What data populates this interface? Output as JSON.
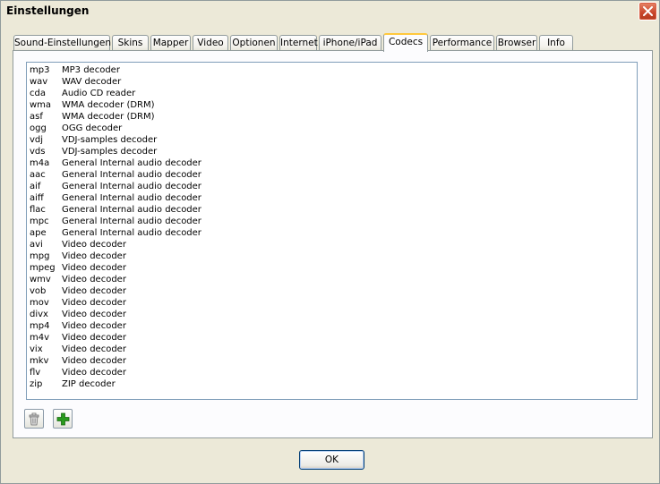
{
  "window": {
    "title": "Einstellungen"
  },
  "tabs": [
    {
      "label": "Sound-Einstellungen"
    },
    {
      "label": "Skins"
    },
    {
      "label": "Mapper"
    },
    {
      "label": "Video"
    },
    {
      "label": "Optionen"
    },
    {
      "label": "Internet"
    },
    {
      "label": "iPhone/iPad"
    },
    {
      "label": "Codecs",
      "active": true
    },
    {
      "label": "Performance"
    },
    {
      "label": "Browser"
    },
    {
      "label": "Info"
    }
  ],
  "codecs": [
    {
      "ext": "mp3",
      "desc": "MP3 decoder"
    },
    {
      "ext": "wav",
      "desc": "WAV decoder"
    },
    {
      "ext": "cda",
      "desc": "Audio CD reader"
    },
    {
      "ext": "wma",
      "desc": "WMA decoder (DRM)"
    },
    {
      "ext": "asf",
      "desc": "WMA decoder (DRM)"
    },
    {
      "ext": "ogg",
      "desc": "OGG decoder"
    },
    {
      "ext": "vdj",
      "desc": "VDJ-samples decoder"
    },
    {
      "ext": "vds",
      "desc": "VDJ-samples decoder"
    },
    {
      "ext": "m4a",
      "desc": "General Internal audio decoder"
    },
    {
      "ext": "aac",
      "desc": "General Internal audio decoder"
    },
    {
      "ext": "aif",
      "desc": "General Internal audio decoder"
    },
    {
      "ext": "aiff",
      "desc": "General Internal audio decoder"
    },
    {
      "ext": "flac",
      "desc": "General Internal audio decoder"
    },
    {
      "ext": "mpc",
      "desc": "General Internal audio decoder"
    },
    {
      "ext": "ape",
      "desc": "General Internal audio decoder"
    },
    {
      "ext": "avi",
      "desc": "Video decoder"
    },
    {
      "ext": "mpg",
      "desc": "Video decoder"
    },
    {
      "ext": "mpeg",
      "desc": "Video decoder"
    },
    {
      "ext": "wmv",
      "desc": "Video decoder"
    },
    {
      "ext": "vob",
      "desc": "Video decoder"
    },
    {
      "ext": "mov",
      "desc": "Video decoder"
    },
    {
      "ext": "divx",
      "desc": "Video decoder"
    },
    {
      "ext": "mp4",
      "desc": "Video decoder"
    },
    {
      "ext": "m4v",
      "desc": "Video decoder"
    },
    {
      "ext": "vix",
      "desc": "Video decoder"
    },
    {
      "ext": "mkv",
      "desc": "Video decoder"
    },
    {
      "ext": "flv",
      "desc": "Video decoder"
    },
    {
      "ext": "zip",
      "desc": "ZIP decoder"
    }
  ],
  "toolbar": {
    "delete_icon": "trash-icon",
    "add_icon": "plus-icon"
  },
  "footer": {
    "ok_label": "OK"
  },
  "colors": {
    "close_red": "#c8452a",
    "active_tab_accent": "#ffc83c",
    "add_green": "#2a9a1e"
  }
}
